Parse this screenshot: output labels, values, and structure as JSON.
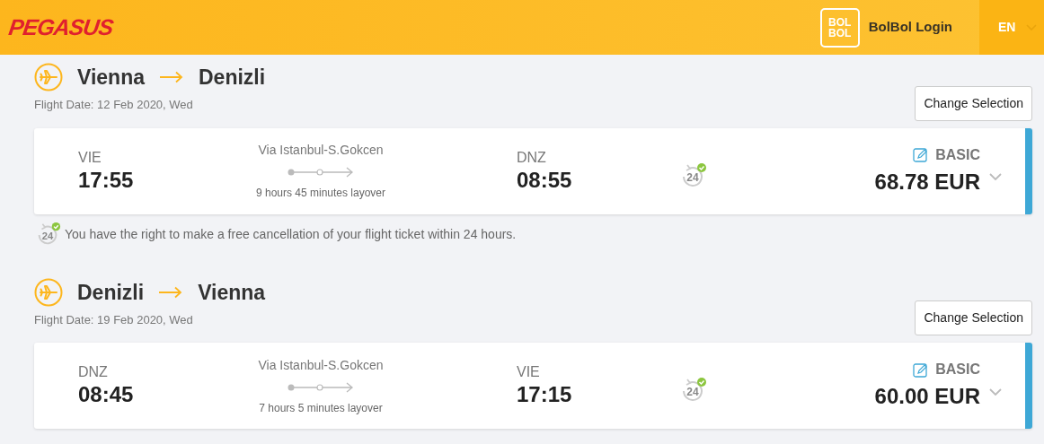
{
  "header": {
    "logo": "PEGASUS",
    "bolbol_badge": "BOL BOL",
    "login": "BolBol Login",
    "language": "EN"
  },
  "segments": [
    {
      "from": "Vienna",
      "to": "Denizli",
      "date": "Flight Date: 12 Feb 2020, Wed",
      "change_button": "Change Selection",
      "departure": {
        "code": "VIE",
        "time": "17:55"
      },
      "via": "Via Istanbul-S.Gokcen",
      "layover": "9 hours 45 minutes layover",
      "arrival": {
        "code": "DNZ",
        "time": "08:55"
      },
      "cancel_badge": "24",
      "notice_badge": "24",
      "fare_class": "BASIC",
      "price": "68.78 EUR",
      "cancel_notice": "You have the right to make a free cancellation of your flight ticket within 24 hours."
    },
    {
      "from": "Denizli",
      "to": "Vienna",
      "date": "Flight Date: 19 Feb 2020, Wed",
      "change_button": "Change Selection",
      "departure": {
        "code": "DNZ",
        "time": "08:45"
      },
      "via": "Via Istanbul-S.Gokcen",
      "layover": "7 hours 5 minutes layover",
      "arrival": {
        "code": "VIE",
        "time": "17:15"
      },
      "cancel_badge": "24",
      "fare_class": "BASIC",
      "price": "60.00 EUR"
    }
  ]
}
